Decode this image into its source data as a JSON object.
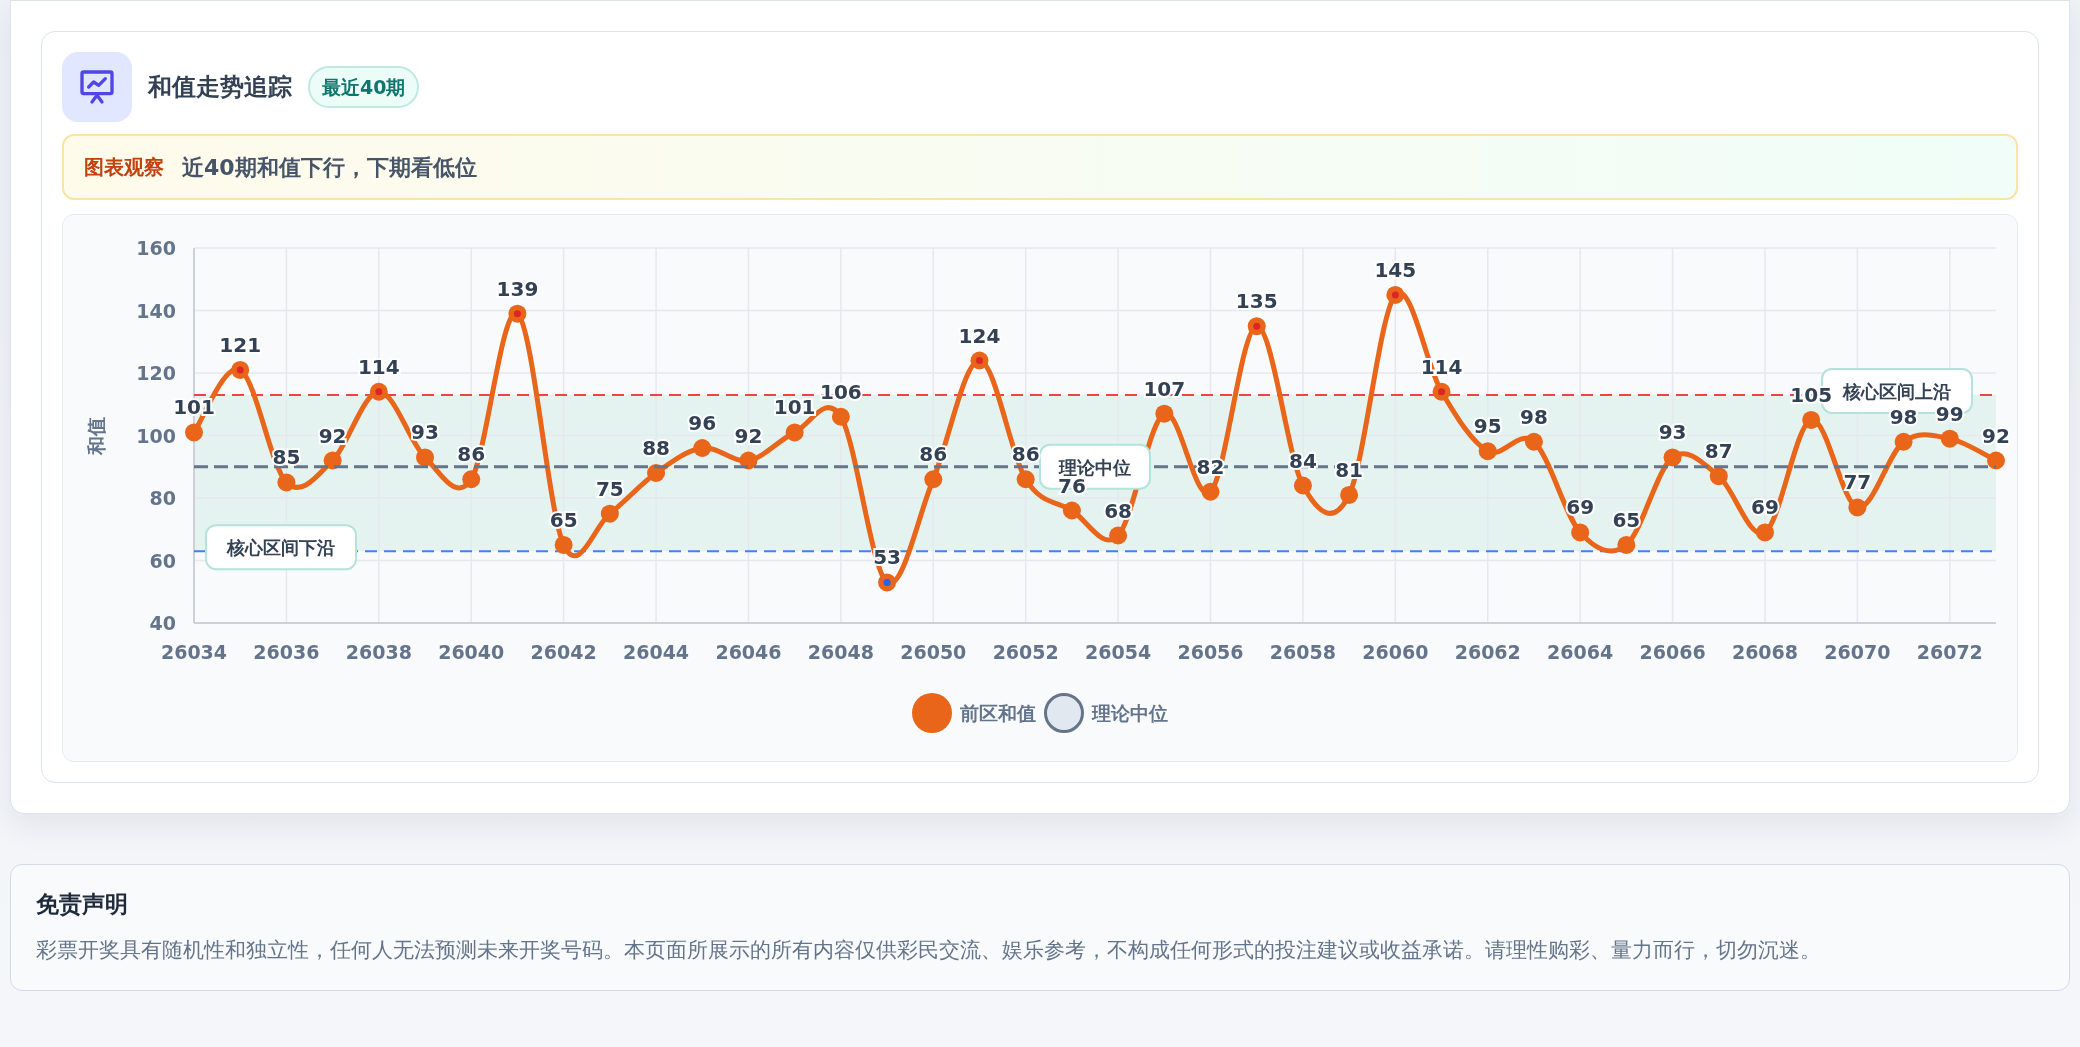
{
  "chart_card": {
    "title": "和值走势追踪",
    "badge": "最近40期",
    "insight": {
      "label": "图表观察",
      "text": "近40期和值下行，下期看低位"
    },
    "chart_data": {
      "type": "line",
      "ylabel": "和值",
      "x": [
        26034,
        26035,
        26036,
        26037,
        26038,
        26039,
        26040,
        26041,
        26042,
        26043,
        26044,
        26045,
        26046,
        26047,
        26048,
        26049,
        26050,
        26051,
        26052,
        26053,
        26054,
        26055,
        26056,
        26057,
        26058,
        26059,
        26060,
        26061,
        26062,
        26063,
        26064,
        26065,
        26066,
        26067,
        26068,
        26069,
        26070,
        26071,
        26072,
        26073
      ],
      "series": [
        {
          "name": "前区和值",
          "color": "#e8651a",
          "marker": "circle",
          "values": [
            101,
            121,
            85,
            92,
            114,
            93,
            86,
            139,
            65,
            75,
            88,
            96,
            92,
            101,
            106,
            53,
            86,
            124,
            86,
            76,
            68,
            107,
            82,
            135,
            84,
            81,
            145,
            114,
            95,
            98,
            69,
            65,
            93,
            87,
            69,
            105,
            77,
            98,
            99,
            92
          ],
          "value_labels": [
            "101",
            "121",
            "85",
            "92",
            "114",
            "93",
            "86",
            "139",
            "65",
            "75",
            "88",
            "96",
            "92",
            "101",
            "106",
            "53",
            "86",
            "124",
            "86",
            "76",
            "68",
            "107",
            "82",
            "135",
            "84",
            "81",
            "145",
            "114",
            "95",
            "98",
            "69",
            "65",
            "93",
            "87",
            "69",
            "105",
            "77",
            "98",
            "99",
            "92"
          ]
        },
        {
          "name": "理论中位",
          "color": "#64748b",
          "line_style": "dashed",
          "values": [
            90,
            90,
            90,
            90,
            90,
            90,
            90,
            90,
            90,
            90,
            90,
            90,
            90,
            90,
            90,
            90,
            90,
            90,
            90,
            null,
            null,
            90,
            90,
            90,
            90,
            90,
            90,
            90,
            90,
            90,
            90,
            90,
            90,
            90,
            90,
            90,
            90,
            90,
            90,
            90
          ]
        }
      ],
      "xlim": [
        26034,
        26073
      ],
      "ylim": [
        40,
        160
      ],
      "xticks": [
        26034,
        26036,
        26038,
        26040,
        26042,
        26044,
        26046,
        26048,
        26050,
        26052,
        26054,
        26056,
        26058,
        26060,
        26062,
        26064,
        26066,
        26068,
        26070,
        26072
      ],
      "yticks": [
        40,
        60,
        80,
        100,
        120,
        140,
        160
      ],
      "grid": true,
      "ref_lines": [
        {
          "axis": "y",
          "value": 113,
          "label": "核心区间上沿",
          "color": "#ef4444"
        },
        {
          "axis": "y",
          "value": 63,
          "label": "核心区间下沿",
          "color": "#3b82f6"
        }
      ],
      "annotations": [
        {
          "text": "理论中位"
        }
      ]
    }
  },
  "disclaimer": {
    "title": "免责声明",
    "text": "彩票开奖具有随机性和独立性，任何人无法预测未来开奖号码。本页面所展示的所有内容仅供彩民交流、娱乐参考，不构成任何形式的投注建议或收益承诺。请理性购彩、量力而行，切勿沉迷。"
  }
}
